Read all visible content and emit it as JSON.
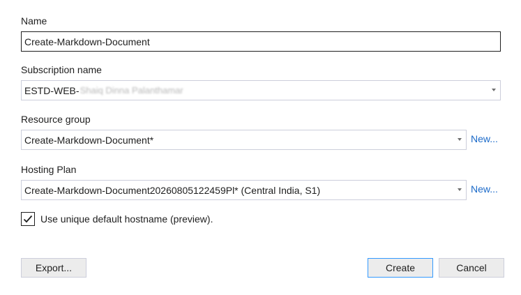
{
  "form": {
    "name_label": "Name",
    "name_value": "Create-Markdown-Document",
    "subscription_label": "Subscription name",
    "subscription_value": "ESTD-WEB-",
    "subscription_value_redacted": "Shaiq Dinna Palanthamar",
    "resource_group_label": "Resource group",
    "resource_group_value": "Create-Markdown-Document*",
    "resource_group_new": "New...",
    "hosting_plan_label": "Hosting Plan",
    "hosting_plan_value": "Create-Markdown-Document20260805122459Pl* (Central India, S1)",
    "hosting_plan_new": "New...",
    "unique_hostname_label": "Use unique default hostname (preview).",
    "unique_hostname_checked": true
  },
  "buttons": {
    "export": "Export...",
    "create": "Create",
    "cancel": "Cancel"
  },
  "colors": {
    "link": "#1b6ac9",
    "primary_border": "#3399ff",
    "button_bg": "#ececec",
    "field_border": "#cccedb"
  }
}
